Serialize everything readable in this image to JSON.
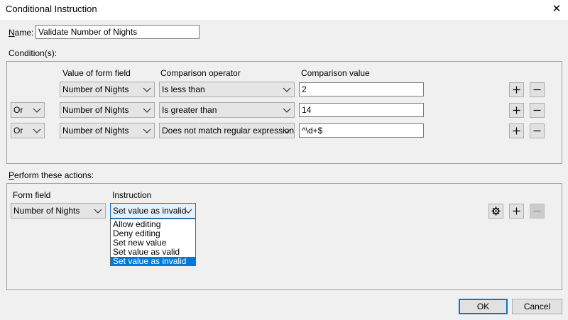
{
  "window": {
    "title": "Conditional Instruction",
    "close_glyph": "✕"
  },
  "name_field": {
    "label": "Name:",
    "value": "Validate Number of Nights"
  },
  "conditions": {
    "label": "Condition(s):",
    "headers": {
      "form_field": "Value of form field",
      "operator": "Comparison operator",
      "value": "Comparison value"
    },
    "rows": [
      {
        "join": "",
        "field": "Number of Nights",
        "operator": "Is less than",
        "value": "2"
      },
      {
        "join": "Or",
        "field": "Number of Nights",
        "operator": "Is greater than",
        "value": "14"
      },
      {
        "join": "Or",
        "field": "Number of Nights",
        "operator": "Does not match regular expression",
        "value": "^\\d+$"
      }
    ]
  },
  "actions": {
    "label": "Perform these actions:",
    "headers": {
      "form_field": "Form field",
      "instruction": "Instruction"
    },
    "row": {
      "field": "Number of Nights",
      "instruction": "Set value as invalid"
    },
    "dropdown_options": [
      "Allow editing",
      "Deny editing",
      "Set new value",
      "Set value as valid",
      "Set value as invalid"
    ],
    "selected_option": "Set value as invalid"
  },
  "footer": {
    "ok_label": "OK",
    "cancel_label": "Cancel"
  },
  "icons": {
    "add": "plus-icon",
    "remove": "minus-icon",
    "settings": "gear-icon",
    "dropdown": "chevron-down-icon"
  },
  "colors": {
    "accent": "#0078d7",
    "window_bg": "#f0f0f0",
    "combo_bg": "#e5e5e5"
  }
}
